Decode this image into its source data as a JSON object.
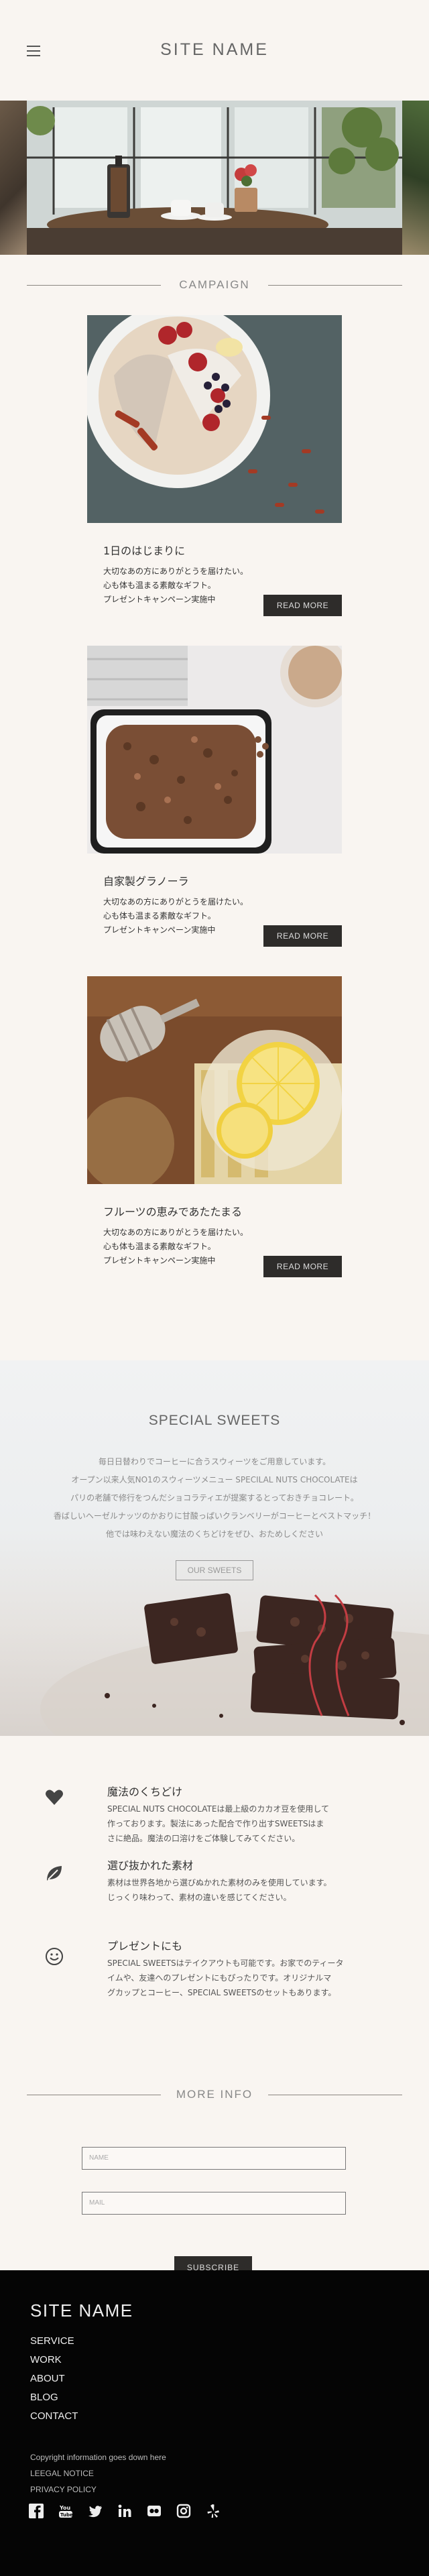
{
  "header": {
    "site_name": "SITE NAME",
    "menu_icon": "hamburger-menu-icon"
  },
  "hero": {
    "image_alt": "cafe table with french press and tea cups"
  },
  "campaign": {
    "heading": "CAMPAIGN",
    "cards": [
      {
        "title": "1日のはじまりに",
        "desc": "大切なあの方にありがとうを届けたい。\n心も体も温まる素敵なギフト。\nプレゼントキャンペーン実施中",
        "button": "READ MORE"
      },
      {
        "title": "自家製グラノーラ",
        "desc": "大切なあの方にありがとうを届けたい。\n心も体も温まる素敵なギフト。\nプレゼントキャンペーン実施中",
        "button": "READ MORE"
      },
      {
        "title": "フルーツの恵みであたたまる",
        "desc": "大切なあの方にありがとうを届けたい。\n心も体も温まる素敵なギフト。\nプレゼントキャンペーン実施中",
        "button": "READ MORE"
      }
    ]
  },
  "special": {
    "title": "SPECIAL SWEETS",
    "text": "毎日日替わりでコーヒーに合うスウィーツをご用意しています。\nオープン以来人気NO1のスウィーツメニュー SPECILAL NUTS CHOCOLATEは\nパリの老舗で修行をつんだショコラティエが提案するとっておきチョコレート。\n香ばしいヘーゼルナッツのかおりに甘酸っぱいクランベリーがコーヒーとベストマッチ！\n他では味わえない魔法のくちどけをぜひ、おためしください",
    "button": "OUR SWEETS"
  },
  "features": [
    {
      "icon": "heart-icon",
      "title": "魔法のくちどけ",
      "desc": "SPECIAL NUTS CHOCOLATEは最上級のカカオ豆を使用して\n作っております。製法にあった配合で作り出すSWEETSはま\nさに絶品。魔法の口溶けをご体験してみてください。"
    },
    {
      "icon": "leaf-icon",
      "title": "選び抜かれた素材",
      "desc": "素材は世界各地から選びぬかれた素材のみを使用しています。\nじっくり味わって、素材の違いを感じてください。"
    },
    {
      "icon": "smile-icon",
      "title": "プレゼントにも",
      "desc": "SPECIAL SWEETSはテイクアウトも可能です。お家でのティータ\nイムや、友達へのプレゼントにもぴったりです。オリジナルマ\nグカップとコーヒー、SPECIAL SWEETSのセットもあります。"
    }
  ],
  "more_info": {
    "heading": "MORE INFO",
    "name_placeholder": "NAME",
    "mail_placeholder": "MAIL",
    "submit": "SUBSCRIBE"
  },
  "footer": {
    "site_name": "SITE NAME",
    "nav": [
      "SERVICE",
      "WORK",
      "ABOUT",
      "BLOG",
      "CONTACT"
    ],
    "copyright": "Copyright information goes down here",
    "legal": "LEEGAL NOTICE",
    "privacy": "PRIVACY POLICY",
    "socials": [
      "facebook-icon",
      "youtube-icon",
      "twitter-icon",
      "linkedin-icon",
      "flickr-icon",
      "instagram-icon",
      "yelp-icon"
    ]
  },
  "colors": {
    "background": "#f9f5f1",
    "button": "#2e2c2a",
    "footer": "#050505",
    "heading_gray": "#888888"
  }
}
